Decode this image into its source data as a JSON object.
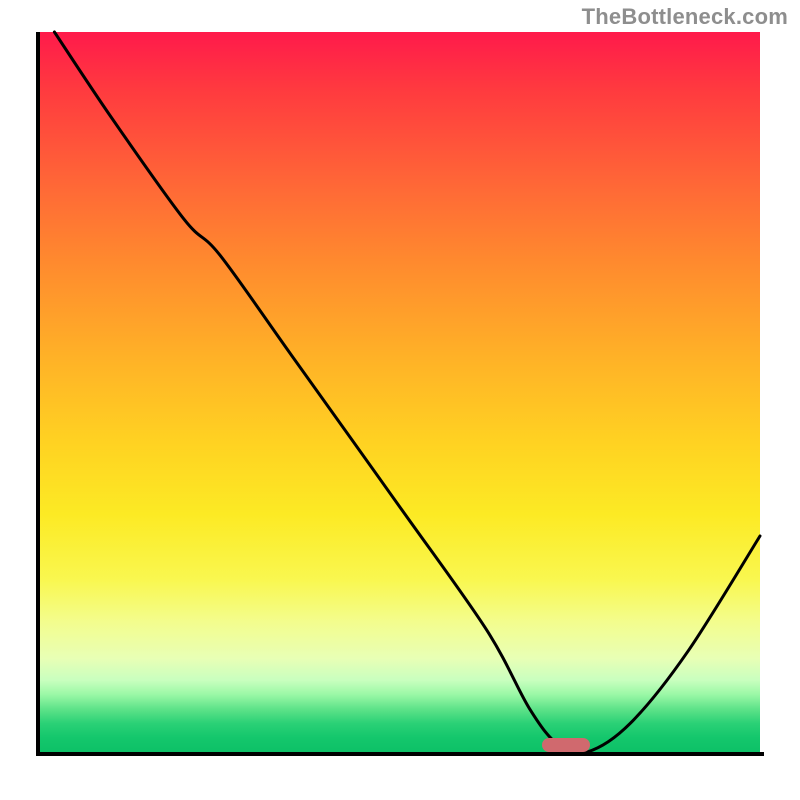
{
  "attribution": "TheBottleneck.com",
  "chart_data": {
    "type": "line",
    "title": "",
    "xlabel": "",
    "ylabel": "",
    "xlim": [
      0,
      100
    ],
    "ylim": [
      0,
      100
    ],
    "axes": {
      "left": true,
      "bottom": true,
      "right": false,
      "top": false
    },
    "grid": false,
    "gradient_stops": [
      {
        "pct": 0,
        "color": "#ff1a4b"
      },
      {
        "pct": 8,
        "color": "#ff3a3f"
      },
      {
        "pct": 22,
        "color": "#ff6a36"
      },
      {
        "pct": 32,
        "color": "#ff8a2e"
      },
      {
        "pct": 45,
        "color": "#ffb127"
      },
      {
        "pct": 57,
        "color": "#ffd222"
      },
      {
        "pct": 67,
        "color": "#fcea24"
      },
      {
        "pct": 76,
        "color": "#f9f74f"
      },
      {
        "pct": 82,
        "color": "#f3fd8e"
      },
      {
        "pct": 87,
        "color": "#e8ffb5"
      },
      {
        "pct": 90,
        "color": "#c9ffbf"
      },
      {
        "pct": 92,
        "color": "#9bf8a6"
      },
      {
        "pct": 94,
        "color": "#5fe389"
      },
      {
        "pct": 96,
        "color": "#2bd176"
      },
      {
        "pct": 98,
        "color": "#14c76c"
      },
      {
        "pct": 100,
        "color": "#0dc167"
      }
    ],
    "series": [
      {
        "name": "bottleneck-curve",
        "stroke": "#000000",
        "x": [
          2,
          10,
          20,
          25,
          35,
          50,
          62,
          68,
          72,
          76,
          82,
          90,
          100
        ],
        "y": [
          100,
          88,
          74,
          69,
          55,
          34,
          17,
          6,
          1,
          0,
          4,
          14,
          30
        ]
      }
    ],
    "marker": {
      "name": "optimal-point",
      "x": 73,
      "y": 1,
      "color": "#d0696e",
      "shape": "pill"
    }
  }
}
